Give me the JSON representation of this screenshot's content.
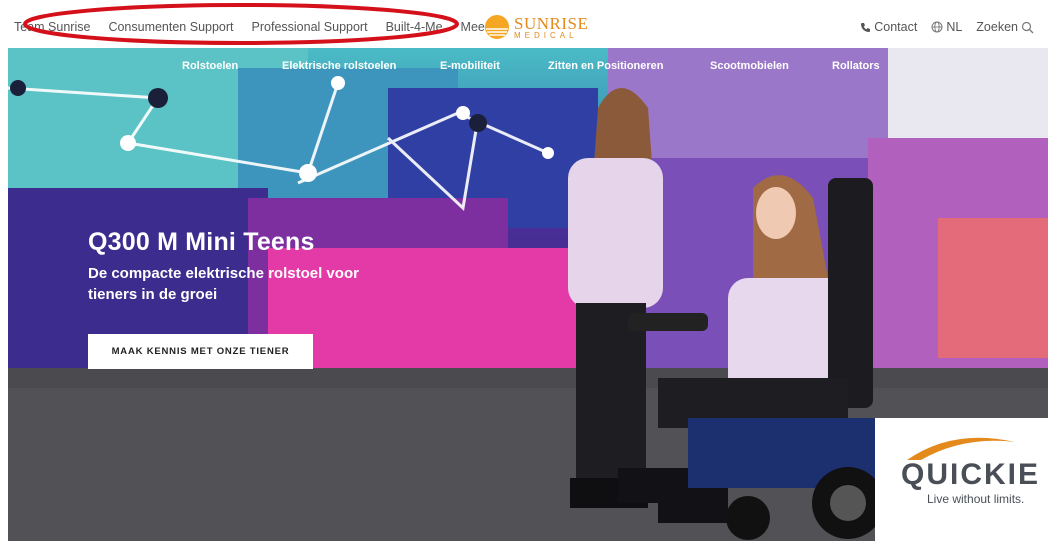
{
  "header": {
    "top_links": [
      "Team Sunrise",
      "Consumenten Support",
      "Professional Support",
      "Built-4-Me",
      "Meer"
    ],
    "logo": {
      "name": "SUNRISE",
      "sub": "MEDICAL"
    },
    "right": {
      "contact": "Contact",
      "language": "NL",
      "search": "Zoeken"
    }
  },
  "nav": [
    "Rolstoelen",
    "Elektrische rolstoelen",
    "E-mobiliteit",
    "Zitten en Positioneren",
    "Scootmobielen",
    "Rollators"
  ],
  "hero": {
    "title": "Q300 M Mini Teens",
    "subtitle": "De compacte elektrische rolstoel voor tieners in de groei",
    "cta": "MAAK KENNIS MET ONZE TIENER"
  },
  "badge": {
    "brand": "QUICKIE",
    "tagline": "Live without limits."
  },
  "colors": {
    "annotation": "#d4101a",
    "logo": "#e48a1d",
    "cta_bg": "#ffffff"
  },
  "icons": [
    "phone-icon",
    "globe-icon",
    "search-icon",
    "chevron-down-icon",
    "sunrise-logo-icon",
    "quickie-swoosh-icon"
  ]
}
